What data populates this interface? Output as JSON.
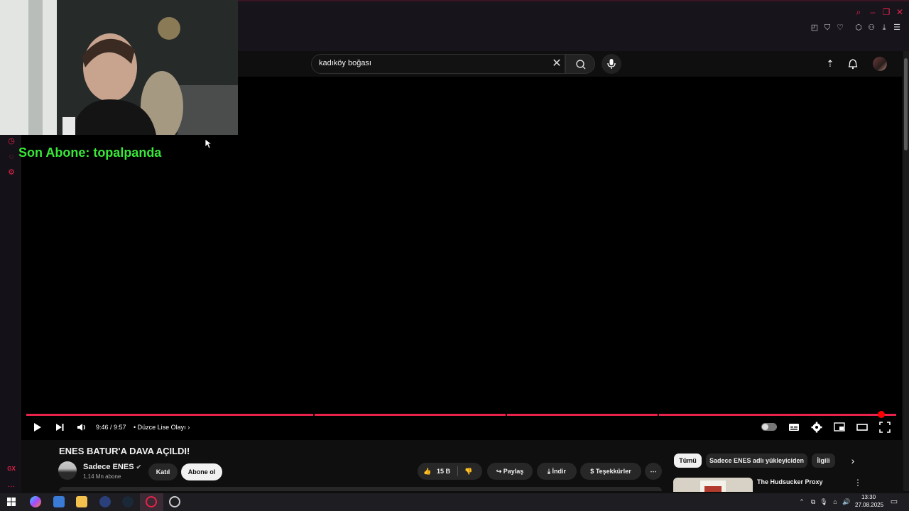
{
  "stream_overlay": {
    "last_subscriber": "Son Abone: topalpanda"
  },
  "search": {
    "value": "kadıköy boğası"
  },
  "player": {
    "time": "9:46 / 9:57",
    "chapter": "• Düzce Lise Olayı",
    "progress_fraction": 0.983
  },
  "video": {
    "title": "ENES BATUR'A DAVA AÇILDI!",
    "channel": "Sadece ENES",
    "subscribers": "1,14 Mn abone",
    "join_label": "Katıl",
    "subscribe_label": "Abone ol",
    "likes": "15 B",
    "share_label": "Paylaş",
    "download_label": "İndir",
    "thanks_label": "Teşekkürler"
  },
  "chips": [
    "Tümü",
    "Sadece ENES adlı yükleyiciden",
    "İlgili"
  ],
  "recommendation": {
    "title": "The Hudsucker Proxy"
  },
  "clock": {
    "time": "13:30",
    "date": "27.08.2025"
  },
  "colors": {
    "accent": "#e8224a",
    "progress": "#ff0000",
    "overlay_text": "#39e639"
  }
}
